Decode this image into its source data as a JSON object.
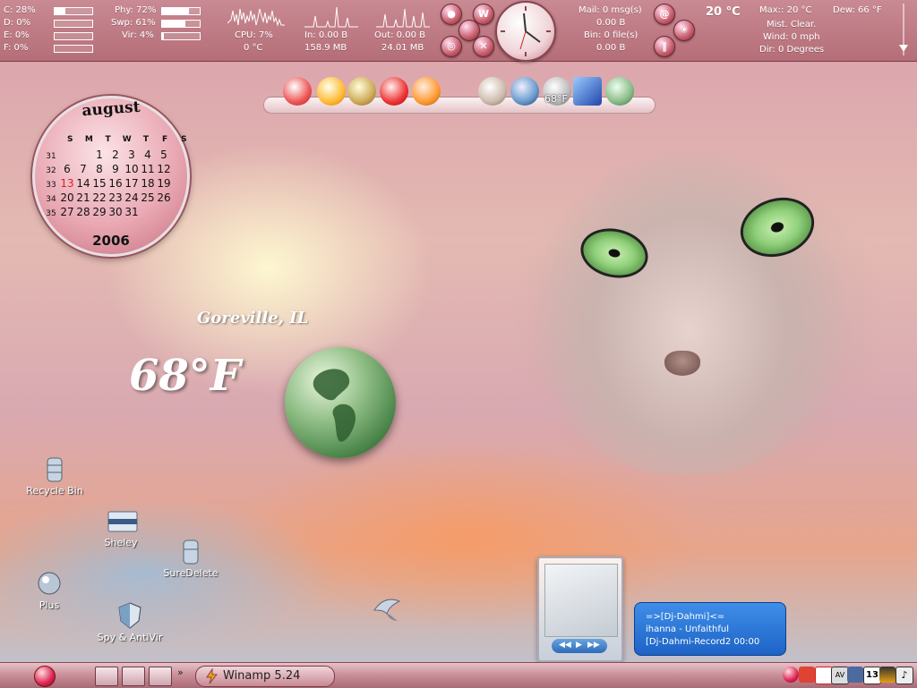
{
  "sysmon": {
    "drives": [
      {
        "label": "C: 28%",
        "fill": 0.28
      },
      {
        "label": "D: 0%",
        "fill": 0
      },
      {
        "label": "E: 0%",
        "fill": 0
      },
      {
        "label": "F: 0%",
        "fill": 0
      }
    ],
    "memory": [
      {
        "label": "Phy: 72%",
        "fill": 0.72
      },
      {
        "label": "Swp: 61%",
        "fill": 0.61
      },
      {
        "label": "Vir: 4%",
        "fill": 0.04
      }
    ],
    "cpu_label": "CPU: 7%",
    "cpu_temp": "0 °C",
    "net_in": "In:  0.00 B",
    "net_in_total": "158.9 MB",
    "net_out": "Out:  0.00 B",
    "net_out_total": "24.01 MB",
    "mail": "Mail: 0 msg(s)",
    "mail_size": "0.00 B",
    "bin": "Bin: 0 file(s)",
    "bin_size": "0.00 B"
  },
  "topweather": {
    "temp": "20 °C",
    "max": "Max:: 20 °C",
    "dew": "Dew: 66 °F",
    "cond": "Mist. Clear.",
    "wind": "Wind: 0 mph",
    "dir": "Dir: 0 Degrees"
  },
  "dock": {
    "weather_label": "68°F"
  },
  "calendar": {
    "month": "august",
    "year": "2006",
    "headers": [
      "S",
      "M",
      "T",
      "W",
      "T",
      "F",
      "S"
    ],
    "weeks": [
      {
        "wk": "31",
        "days": [
          "",
          "",
          "1",
          "2",
          "3",
          "4",
          "5"
        ]
      },
      {
        "wk": "32",
        "days": [
          "6",
          "7",
          "8",
          "9",
          "10",
          "11",
          "12"
        ]
      },
      {
        "wk": "33",
        "days": [
          "13",
          "14",
          "15",
          "16",
          "17",
          "18",
          "19"
        ]
      },
      {
        "wk": "34",
        "days": [
          "20",
          "21",
          "22",
          "23",
          "24",
          "25",
          "26"
        ]
      },
      {
        "wk": "35",
        "days": [
          "27",
          "28",
          "29",
          "30",
          "31",
          "",
          ""
        ]
      }
    ],
    "today": "13"
  },
  "weather": {
    "location": "Goreville, IL",
    "temp": "68°F"
  },
  "desktop_icons": {
    "recycle": "Recycle Bin",
    "sheley": "Sheley",
    "suredelete": "SureDelete",
    "plus": "Plus",
    "spy": "Spy & AntiVir"
  },
  "nowplaying": {
    "line1": "=>[Dj-Dahmi]<=",
    "line2": "ihanna - Unfaithful",
    "line3": "[Dj-Dahmi-Record2    00:00"
  },
  "taskbar": {
    "task": "Winamp 5.24",
    "tray_date": "13"
  },
  "colors": {
    "topbar": "#b56e78",
    "taskbar": "#c88d97",
    "bubble": "#1d63c6",
    "today": "#dd2222"
  }
}
